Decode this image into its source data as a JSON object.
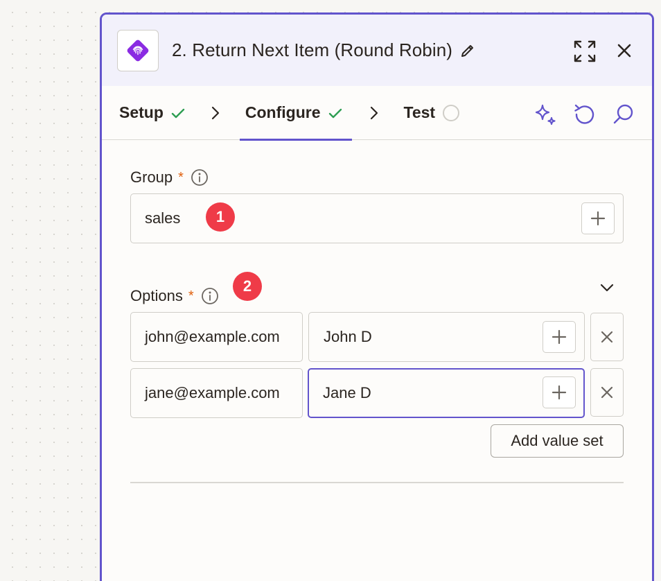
{
  "panel": {
    "title": "2. Return Next Item (Round Robin)",
    "app_icon": "fingerprint-icon"
  },
  "tabs": [
    {
      "label": "Setup",
      "status": "complete"
    },
    {
      "label": "Configure",
      "status": "complete",
      "active": true
    },
    {
      "label": "Test",
      "status": "pending"
    }
  ],
  "group": {
    "label": "Group",
    "required_mark": "*",
    "value": "sales",
    "badge": "1"
  },
  "options": {
    "label": "Options",
    "required_mark": "*",
    "badge": "2",
    "rows": [
      {
        "key": "john@example.com",
        "value": "John D"
      },
      {
        "key": "jane@example.com",
        "value": "Jane D"
      }
    ],
    "add_label": "Add value set"
  },
  "colors": {
    "accent": "#6254cc",
    "success": "#2e9e52",
    "badge": "#ef3b48",
    "required": "#e0600e"
  }
}
